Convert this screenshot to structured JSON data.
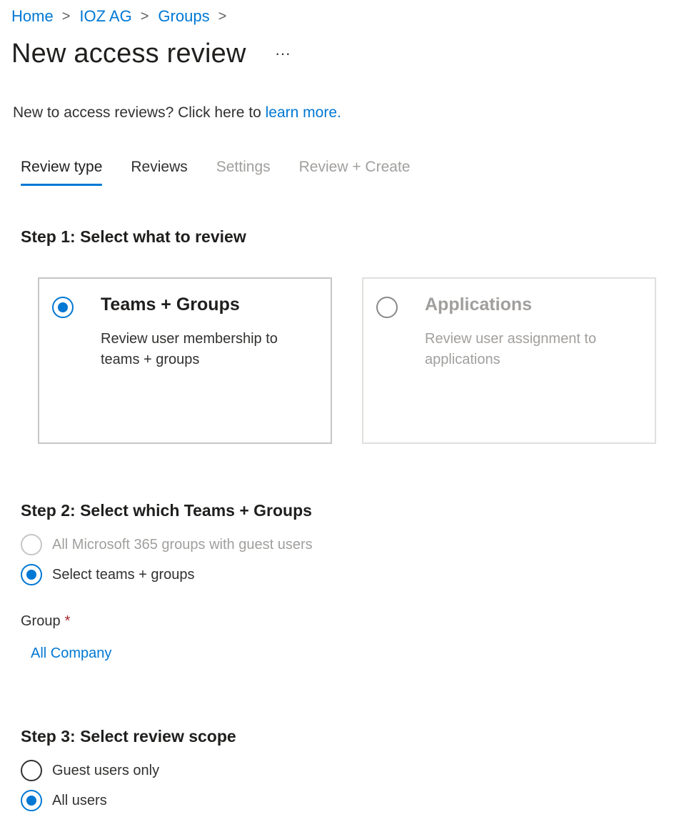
{
  "breadcrumb": {
    "items": [
      "Home",
      "IOZ AG",
      "Groups"
    ],
    "separator": ">"
  },
  "page": {
    "title": "New access review",
    "more_label": "···"
  },
  "intro": {
    "text": "New to access reviews? Click here to ",
    "link": "learn more."
  },
  "tabs": [
    {
      "label": "Review type",
      "state": "active"
    },
    {
      "label": "Reviews",
      "state": "enabled"
    },
    {
      "label": "Settings",
      "state": "disabled"
    },
    {
      "label": "Review + Create",
      "state": "disabled"
    }
  ],
  "step1": {
    "heading": "Step 1: Select what to review",
    "cards": [
      {
        "title": "Teams + Groups",
        "description": "Review user membership to teams + groups",
        "selected": true
      },
      {
        "title": "Applications",
        "description": "Review user assignment to applications",
        "selected": false
      }
    ]
  },
  "step2": {
    "heading": "Step 2: Select which Teams + Groups",
    "options": [
      {
        "label": "All Microsoft 365 groups with guest users",
        "selected": false,
        "disabled": true
      },
      {
        "label": "Select teams + groups",
        "selected": true,
        "disabled": false
      }
    ],
    "group_label": "Group",
    "required_mark": "*",
    "group_value": "All Company"
  },
  "step3": {
    "heading": "Step 3: Select review scope",
    "options": [
      {
        "label": "Guest users only",
        "selected": false
      },
      {
        "label": "All users",
        "selected": true
      }
    ]
  },
  "colors": {
    "accent": "#0078d4",
    "text": "#323130",
    "disabled": "#a19f9d",
    "required": "#a4262c"
  }
}
